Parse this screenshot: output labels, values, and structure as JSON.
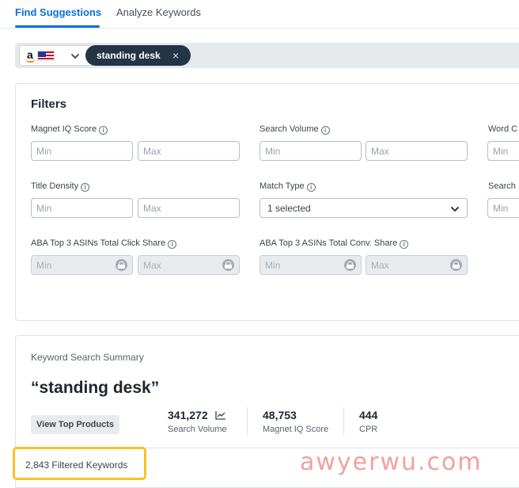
{
  "tabs": [
    {
      "label": "Find Suggestions",
      "active": true
    },
    {
      "label": "Analyze Keywords",
      "active": false
    }
  ],
  "search": {
    "marketplace_icon": "amazon-us-flag-icon",
    "chip_label": "standing desk",
    "chip_remove": "×"
  },
  "filters": {
    "title": "Filters",
    "info_glyph": "i",
    "magnet_iq": {
      "label": "Magnet IQ Score",
      "min_placeholder": "Min",
      "max_placeholder": "Max"
    },
    "search_volume": {
      "label": "Search Volume",
      "min_placeholder": "Min",
      "max_placeholder": "Max"
    },
    "word_count": {
      "label": "Word C",
      "min_placeholder": "Min"
    },
    "title_density": {
      "label": "Title Density",
      "min_placeholder": "Min",
      "max_placeholder": "Max"
    },
    "match_type": {
      "label": "Match Type",
      "value": "1 selected"
    },
    "search_partial": {
      "label": "Search",
      "min_placeholder": "Min"
    },
    "aba_click_share": {
      "label": "ABA Top 3 ASINs Total Click Share",
      "min_placeholder": "Min",
      "max_placeholder": "Max"
    },
    "aba_conv_share": {
      "label": "ABA Top 3 ASINs Total Conv. Share",
      "min_placeholder": "Min",
      "max_placeholder": "Max"
    }
  },
  "summary": {
    "caption": "Keyword Search Summary",
    "term": "“standing desk”",
    "view_button": "View Top Products",
    "metrics": [
      {
        "value": "341,272",
        "label": "Search Volume"
      },
      {
        "value": "48,753",
        "label": "Magnet IQ Score"
      },
      {
        "value": "444",
        "label": "CPR"
      }
    ]
  },
  "results": {
    "filtered_keywords": "2,843 Filtered Keywords"
  },
  "watermark": "awyerwu.com",
  "colors": {
    "accent": "#0b6fd6",
    "chip": "#243447",
    "highlight": "#f7c325",
    "watermark": "#ef7f80"
  }
}
